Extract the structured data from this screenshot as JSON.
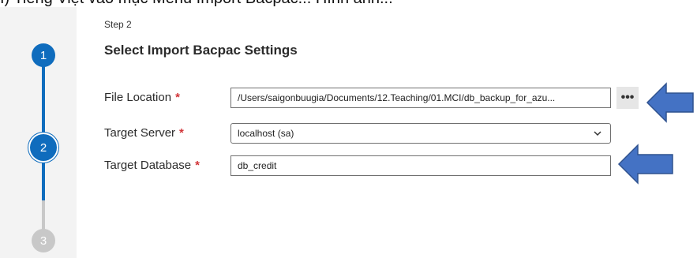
{
  "overlay": {
    "clipped_caption": "I) Tiếng Việt vào mục Menu Import Bacpac... Hình ảnh...",
    "colors": {
      "arrow": "#4472c4",
      "accent": "#0f6cbd",
      "required": "#d13438"
    }
  },
  "stepper": {
    "steps": [
      {
        "number": "1",
        "state": "completed"
      },
      {
        "number": "2",
        "state": "current"
      },
      {
        "number": "3",
        "state": "pending"
      }
    ]
  },
  "wizard": {
    "step_label": "Step 2",
    "title": "Select Import Bacpac Settings",
    "required_marker": "*",
    "fields": {
      "file_location": {
        "label": "File Location",
        "value": "/Users/saigonbuugia/Documents/12.Teaching/01.MCI/db_backup_for_azu..."
      },
      "browse_button": {
        "label": "•••"
      },
      "target_server": {
        "label": "Target Server",
        "value": "localhost (sa)",
        "icon": "chevron-down-icon"
      },
      "target_database": {
        "label": "Target Database",
        "value": "db_credit"
      }
    }
  },
  "annotations": {
    "arrows": [
      {
        "icon": "arrow-left-icon",
        "points_to": "browse_button"
      },
      {
        "icon": "arrow-left-icon",
        "points_to": "target_database"
      }
    ]
  }
}
